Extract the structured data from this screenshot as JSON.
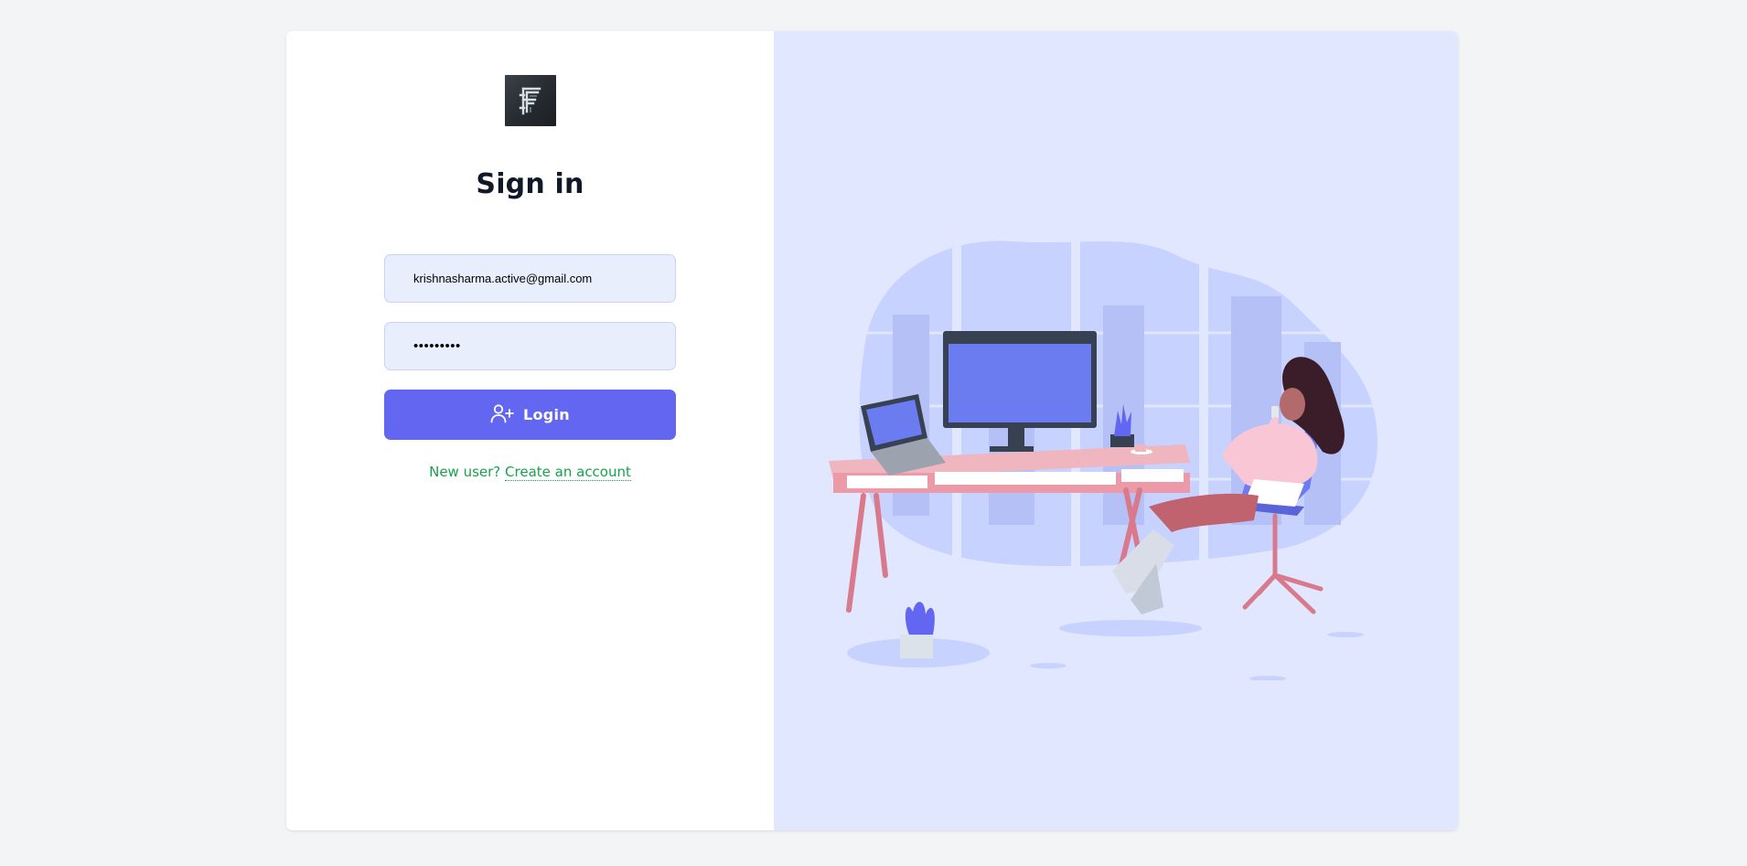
{
  "auth": {
    "title": "Sign in",
    "email_value": "krishnasharma.active@gmail.com",
    "password_value": "•••••••••",
    "login_label": "Login",
    "new_user_text": "New user?",
    "create_account_label": "Create an account"
  },
  "colors": {
    "page_background": "#f3f4f6",
    "accent": "#6366f1",
    "input_background": "#e8eefc",
    "link": "#16a34a",
    "illustration_background": "#e0e7ff"
  },
  "icons": {
    "logo": "f-letter-logo",
    "login": "user-plus-icon"
  }
}
